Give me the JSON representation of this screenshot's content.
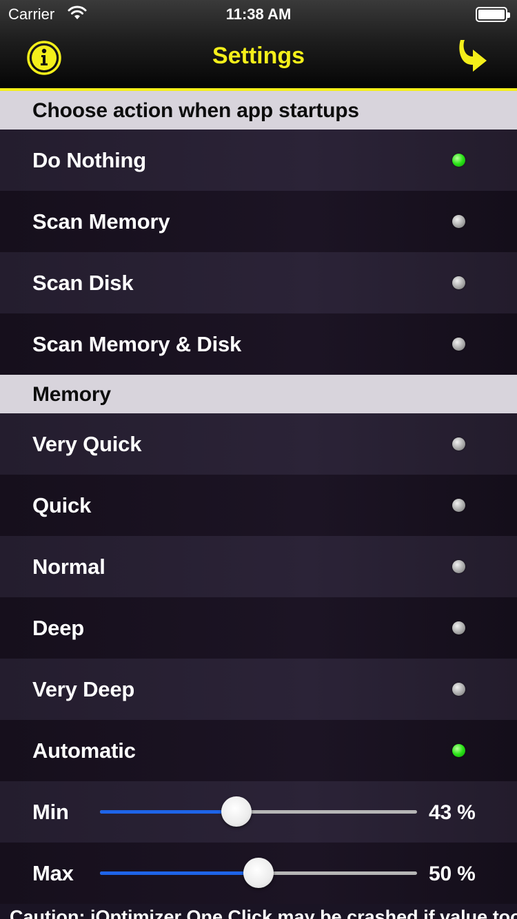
{
  "status_bar": {
    "carrier": "Carrier",
    "time": "11:38 AM"
  },
  "nav": {
    "title": "Settings",
    "left_icon": "info-icon",
    "right_icon": "share-arrow-icon",
    "accent": "#f4ef1a"
  },
  "startup": {
    "header": "Choose action when app startups",
    "options": [
      {
        "label": "Do Nothing",
        "selected": true
      },
      {
        "label": "Scan Memory",
        "selected": false
      },
      {
        "label": "Scan Disk",
        "selected": false
      },
      {
        "label": "Scan Memory & Disk",
        "selected": false
      }
    ]
  },
  "memory": {
    "header": "Memory",
    "options": [
      {
        "label": "Very Quick",
        "selected": false
      },
      {
        "label": "Quick",
        "selected": false
      },
      {
        "label": "Normal",
        "selected": false
      },
      {
        "label": "Deep",
        "selected": false
      },
      {
        "label": "Very Deep",
        "selected": false
      },
      {
        "label": "Automatic",
        "selected": true
      }
    ],
    "min": {
      "label": "Min",
      "value_text": "43 %",
      "fraction": 0.43
    },
    "max": {
      "label": "Max",
      "value_text": "50 %",
      "fraction": 0.5
    }
  },
  "footer": {
    "caution": "Caution: iOptimizer One Click may be crashed if value too"
  },
  "colors": {
    "selected_dot": "#29e316",
    "unselected_dot": "#a9a9a9",
    "slider_fill": "#1e64e8"
  }
}
